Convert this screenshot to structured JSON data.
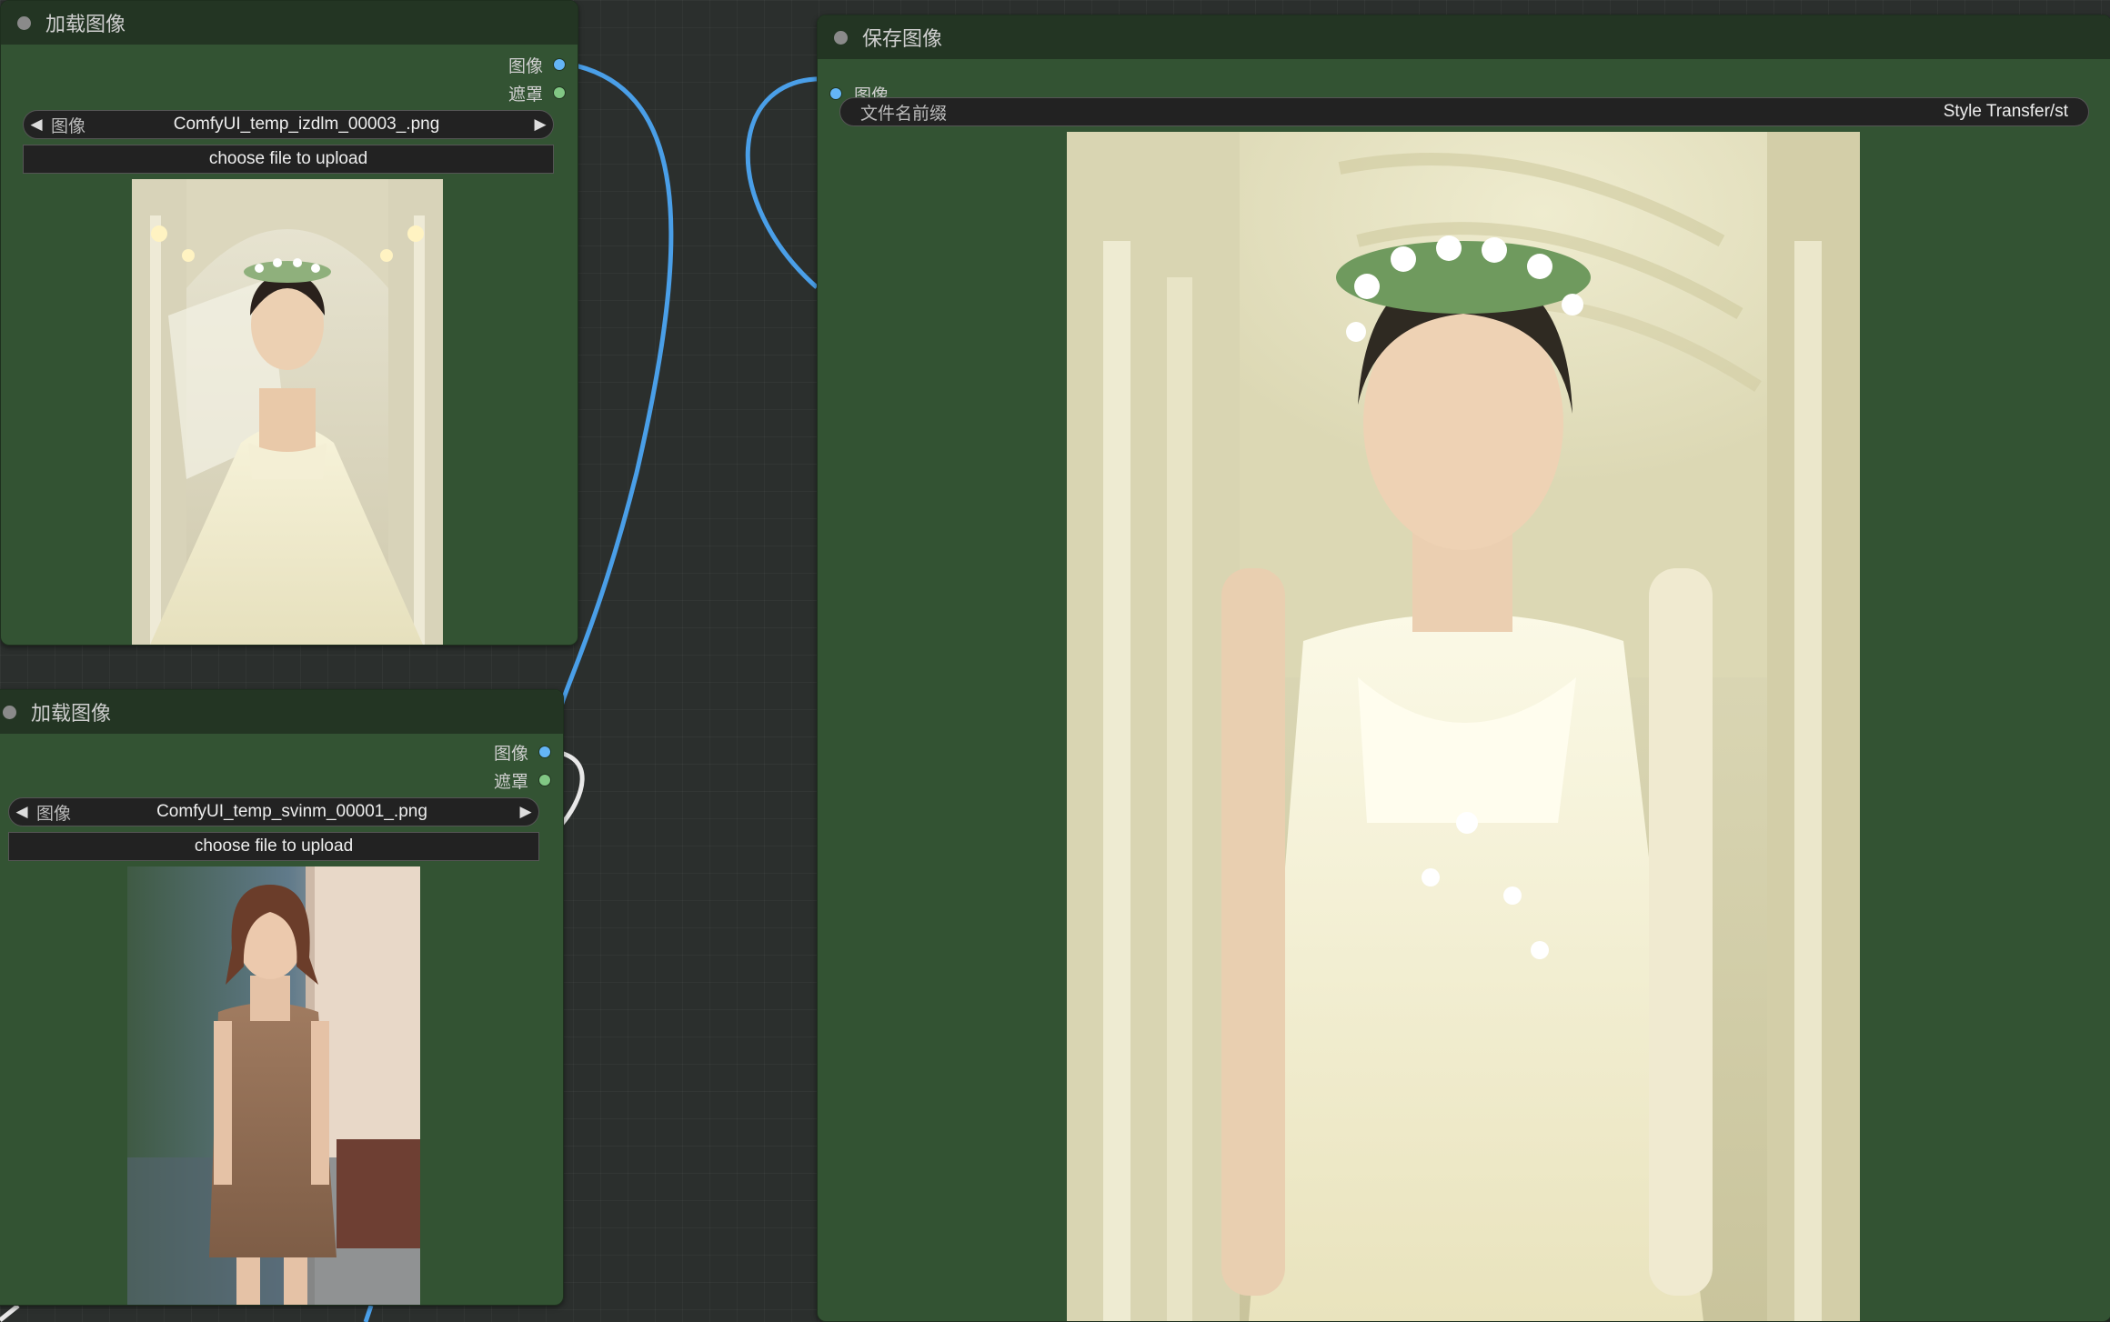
{
  "canvas": {
    "background": "#2b2f2d",
    "node_color": "#335333",
    "header_color": "#233523",
    "wire_color": "#4a9fe8"
  },
  "load_image_1": {
    "title": "加载图像",
    "outputs": {
      "image": "图像",
      "mask": "遮罩"
    },
    "combo": {
      "label": "图像",
      "value": "ComfyUI_temp_izdlm_00003_.png"
    },
    "upload_label": "choose file to upload"
  },
  "load_image_2": {
    "title": "加载图像",
    "outputs": {
      "image": "图像",
      "mask": "遮罩"
    },
    "combo": {
      "label": "图像",
      "value": "ComfyUI_temp_svinm_00001_.png"
    },
    "upload_label": "choose file to upload"
  },
  "save_image": {
    "title": "保存图像",
    "input": {
      "image": "图像"
    },
    "filename_prefix": {
      "label": "文件名前缀",
      "value": "Style Transfer/st"
    }
  },
  "icons": {
    "prev": "◀",
    "next": "▶"
  }
}
